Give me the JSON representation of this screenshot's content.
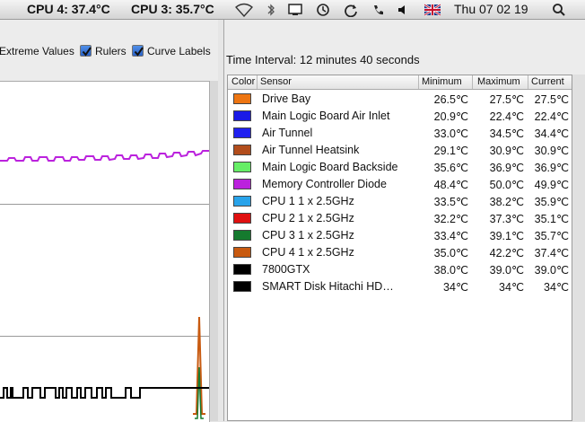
{
  "menubar": {
    "cpu4": "CPU 4: 37.4°C",
    "cpu3": "CPU 3: 35.7°C",
    "clock": "Thu 07 02 19",
    "icons": [
      "wifi-icon",
      "bluetooth-icon",
      "display-icon",
      "time-machine-icon",
      "sync-icon",
      "phone-icon",
      "volume-icon",
      "uk-flag-icon",
      "spotlight-icon"
    ]
  },
  "toolbar": {
    "extreme_values_label": "Extreme Values",
    "rulers_label": "Rulers",
    "curve_labels_label": "Curve Labels",
    "rulers_checked": true,
    "curve_labels_checked": true
  },
  "interval": "Time Interval: 12 minutes 40 seconds",
  "table": {
    "columns": [
      "Color",
      "Sensor",
      "Minimum",
      "Maximum",
      "Current"
    ],
    "rows": [
      {
        "color": "#ed7512",
        "sensor": "Drive Bay",
        "min": "26.5℃",
        "max": "27.5℃",
        "cur": "27.5℃"
      },
      {
        "color": "#1a1ae6",
        "sensor": "Main Logic Board Air Inlet",
        "min": "20.9℃",
        "max": "22.4℃",
        "cur": "22.4℃"
      },
      {
        "color": "#2020f0",
        "sensor": "Air Tunnel",
        "min": "33.0℃",
        "max": "34.5℃",
        "cur": "34.4℃"
      },
      {
        "color": "#b24d1c",
        "sensor": "Air Tunnel Heatsink",
        "min": "29.1℃",
        "max": "30.9℃",
        "cur": "30.9℃"
      },
      {
        "color": "#66ee66",
        "sensor": "Main Logic Board Backside",
        "min": "35.6℃",
        "max": "36.9℃",
        "cur": "36.9℃"
      },
      {
        "color": "#bb22dd",
        "sensor": "Memory Controller Diode",
        "min": "48.4℃",
        "max": "50.0℃",
        "cur": "49.9℃"
      },
      {
        "color": "#29a3ea",
        "sensor": "CPU 1   1 x 2.5GHz",
        "min": "33.5℃",
        "max": "38.2℃",
        "cur": "35.9℃"
      },
      {
        "color": "#e01010",
        "sensor": "CPU 2   1 x 2.5GHz",
        "min": "32.2℃",
        "max": "37.3℃",
        "cur": "35.1℃"
      },
      {
        "color": "#157a2e",
        "sensor": "CPU 3   1 x 2.5GHz",
        "min": "33.4℃",
        "max": "39.1℃",
        "cur": "35.7℃"
      },
      {
        "color": "#c85a10",
        "sensor": "CPU 4   1 x 2.5GHz",
        "min": "35.0℃",
        "max": "42.2℃",
        "cur": "37.4℃"
      },
      {
        "color": "#000000",
        "sensor": "7800GTX",
        "min": "38.0℃",
        "max": "39.0℃",
        "cur": "39.0℃"
      },
      {
        "color": "#000000",
        "sensor": "SMART Disk Hitachi HD…",
        "min": "34℃",
        "max": "34℃",
        "cur": "34℃"
      }
    ]
  }
}
